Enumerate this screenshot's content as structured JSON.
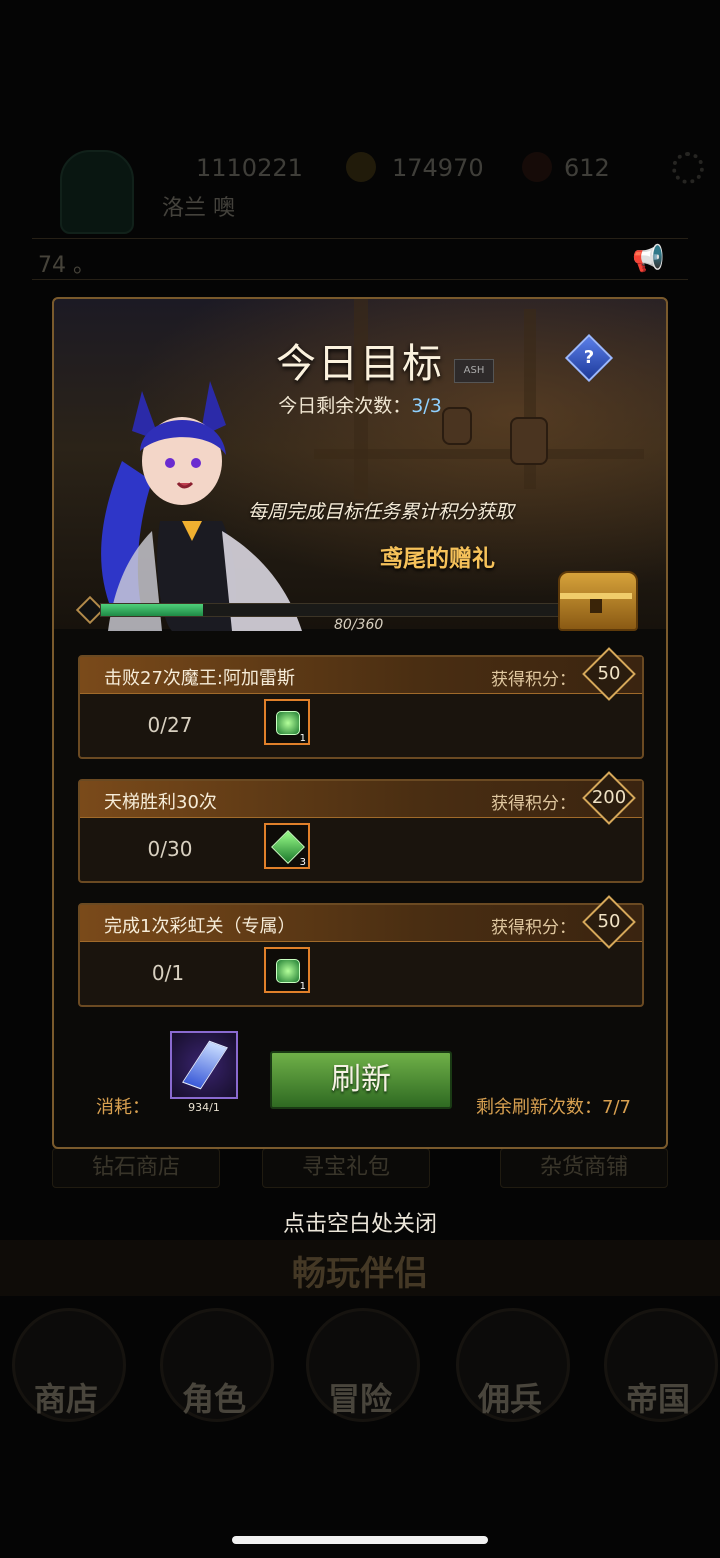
{
  "background": {
    "resources": [
      "1110221",
      "174970",
      "612"
    ],
    "player_name": "洛兰 噢",
    "marquee": "74 。",
    "tabs": [
      "钻石商店",
      "寻宝礼包",
      "杂货商铺"
    ],
    "banner": "畅玩伴侣",
    "nav": [
      "商店",
      "角色",
      "冒险",
      "佣兵",
      "帝国"
    ]
  },
  "modal": {
    "title": "今日目标",
    "remaining_label": "今日剩余次数：",
    "remaining_value": "3/3",
    "weekly_text": "每周完成目标任务累计积分获取",
    "gift_title": "鸢尾的赠礼",
    "progress_text": "80/360",
    "progress": {
      "current": 80,
      "max": 360
    },
    "sign_text": "ASH"
  },
  "tasks": [
    {
      "name": "击败27次魔王:阿加雷斯",
      "points_label": "获得积分：",
      "points": "50",
      "progress": "0/27",
      "reward_qty": "1",
      "reward_icon": "green-gem-icon"
    },
    {
      "name": "天梯胜利30次",
      "points_label": "获得积分：",
      "points": "200",
      "progress": "0/30",
      "reward_qty": "3",
      "reward_icon": "green-crystal-icon"
    },
    {
      "name": "完成1次彩虹关（专属）",
      "points_label": "获得积分：",
      "points": "50",
      "progress": "0/1",
      "reward_qty": "1",
      "reward_icon": "green-gem-icon"
    }
  ],
  "footer": {
    "cost_label": "消耗：",
    "cost_qty": "934/1",
    "refresh_label": "刷新",
    "refresh_count": "剩余刷新次数：7/7"
  },
  "close_hint": "点击空白处关闭",
  "colors": {
    "accent_gold": "#d6a85a",
    "progress_green": "#3fb86a",
    "button_green": "#4e8e34",
    "highlight_blue": "#8fd0ff"
  }
}
